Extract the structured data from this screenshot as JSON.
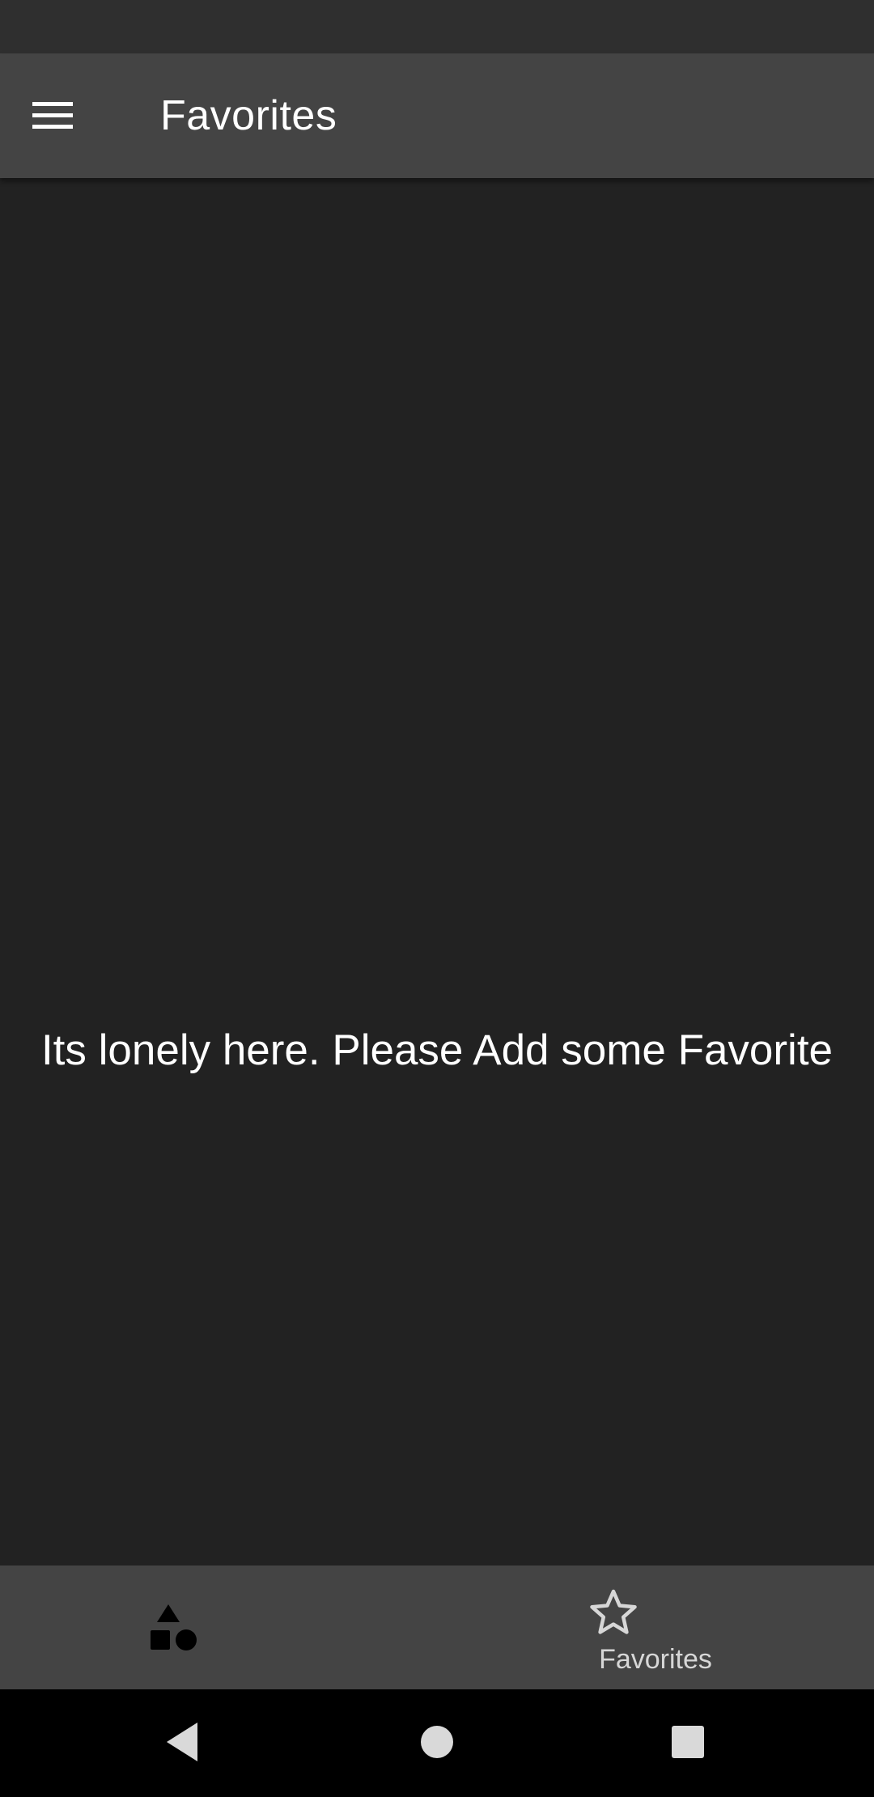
{
  "app_bar": {
    "title": "Favorites",
    "menu_icon": "hamburger-menu-icon"
  },
  "content": {
    "empty_message": "Its lonely here. Please Add some Favorite"
  },
  "bottom_nav": {
    "items": [
      {
        "icon": "categories-icon",
        "label": "",
        "selected": false
      },
      {
        "icon": "star-outline-icon",
        "label": "Favorites",
        "selected": true
      }
    ]
  },
  "system_nav": {
    "back_icon": "back-triangle-icon",
    "home_icon": "home-circle-icon",
    "recents_icon": "recents-square-icon"
  },
  "colors": {
    "background": "#222222",
    "app_bar": "#444444",
    "status_bar": "#2f2f2f",
    "bottom_nav": "#444444",
    "system_nav": "#000000",
    "text_primary": "#ffffff",
    "nav_label": "#d7d7d7"
  }
}
